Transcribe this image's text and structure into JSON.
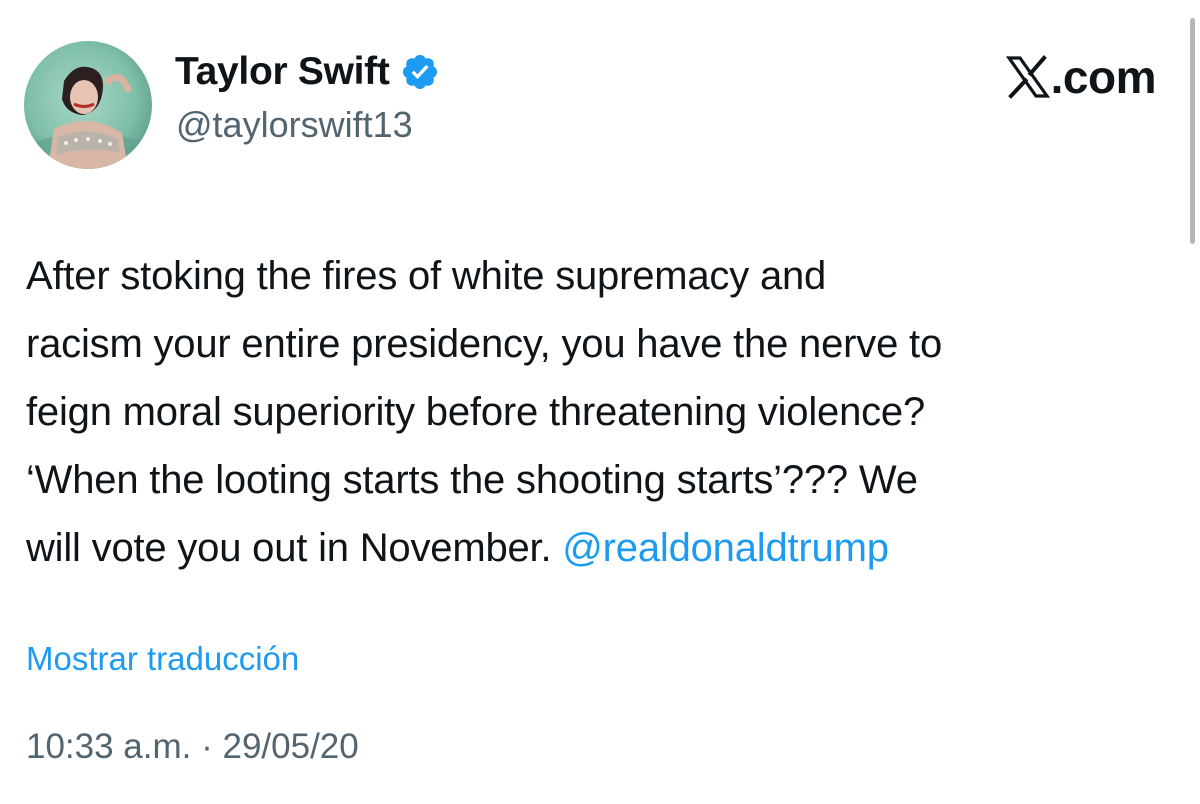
{
  "header": {
    "display_name": "Taylor Swift",
    "handle": "@taylorswift13",
    "verified_icon": "verified-badge-icon",
    "avatar_icon": "profile-avatar"
  },
  "brand": {
    "label": ".com",
    "logo_icon": "x-logo-icon"
  },
  "tweet": {
    "lines": [
      "After stoking the fires of white supremacy and",
      "racism your entire presidency, you have the nerve to",
      "feign moral superiority before threatening violence?",
      "‘When the looting starts the shooting starts’??? We"
    ],
    "last_line_text": "will vote you out in November. ",
    "mention": "@realdonaldtrump"
  },
  "translate_link": "Mostrar traducción",
  "timestamp": "10:33 a.m. · 29/05/20",
  "colors": {
    "link": "#1d9bf0",
    "text": "#0f1419",
    "secondary": "#536471",
    "verified": "#1d9bf0"
  }
}
